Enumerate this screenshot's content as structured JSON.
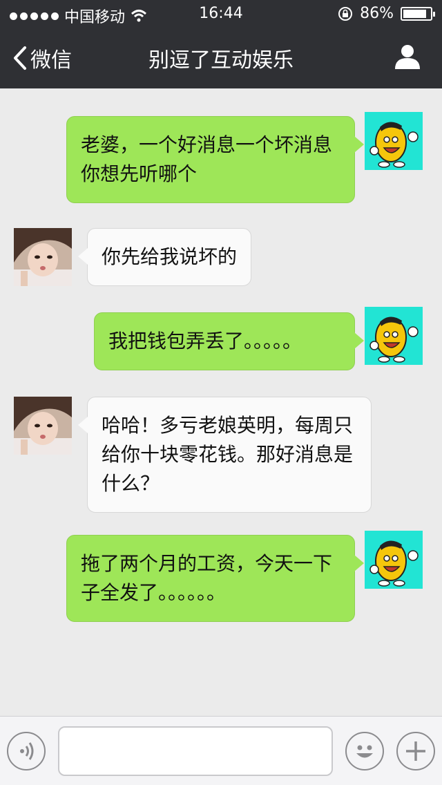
{
  "status_bar": {
    "carrier": "中国移动",
    "time": "16:44",
    "battery": "86%",
    "battery_level": 0.86
  },
  "nav": {
    "back_label": "微信",
    "title": "别逗了互动娱乐"
  },
  "messages": [
    {
      "side": "me",
      "lines": [
        "老婆，一个好消息一个坏消息",
        "你想先听哪个"
      ]
    },
    {
      "side": "them",
      "lines": [
        "你先给我说坏的"
      ]
    },
    {
      "side": "me",
      "lines": [
        "我把钱包弄丢了。。。。。"
      ]
    },
    {
      "side": "them",
      "lines": [
        "哈哈！多亏老娘英明，每周只",
        "给你十块零花钱。那好消息是",
        "什么？"
      ]
    },
    {
      "side": "me",
      "lines": [
        "拖了两个月的工资，今天一下",
        "子全发了。。。。。。"
      ]
    }
  ],
  "icons": {
    "signal": "signal-dots-icon",
    "wifi": "wifi-icon",
    "rotation_lock": "rotation-lock-icon",
    "battery": "battery-icon",
    "back": "chevron-left-icon",
    "profile": "user-profile-icon",
    "voice": "voice-icon",
    "emoji": "emoji-icon",
    "more": "plus-icon"
  },
  "colors": {
    "topbar": "#2f3034",
    "my_bubble": "#9ee658",
    "their_bubble": "#fafafa",
    "background": "#ebebeb"
  }
}
